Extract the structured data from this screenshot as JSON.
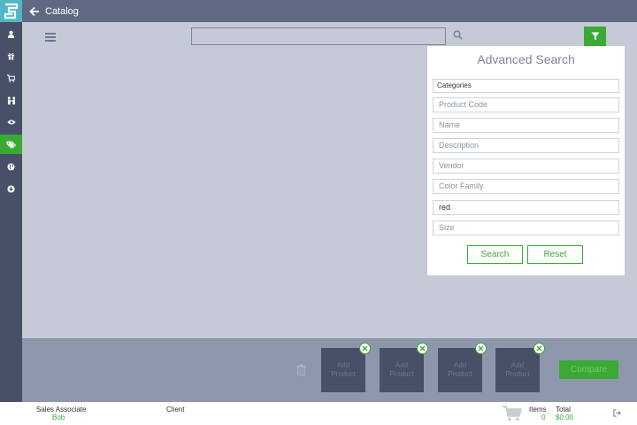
{
  "header": {
    "title": "Catalog"
  },
  "sidebar": {
    "items": [
      {
        "icon": "user-icon"
      },
      {
        "icon": "gift-icon"
      },
      {
        "icon": "cart-icon"
      },
      {
        "icon": "people-icon"
      },
      {
        "icon": "eye-icon"
      },
      {
        "icon": "tags-icon",
        "active": true
      },
      {
        "icon": "globe-icon"
      },
      {
        "icon": "download-icon"
      }
    ]
  },
  "search": {
    "value": "",
    "placeholder": ""
  },
  "advanced_search": {
    "title": "Advanced Search",
    "categories_label": "Categories",
    "fields": [
      {
        "placeholder": "Product Code",
        "value": ""
      },
      {
        "placeholder": "Name",
        "value": ""
      },
      {
        "placeholder": "Description",
        "value": ""
      },
      {
        "placeholder": "Vendor",
        "value": ""
      },
      {
        "placeholder": "Color Family",
        "value": ""
      },
      {
        "placeholder": "",
        "value": "red"
      },
      {
        "placeholder": "Size",
        "value": ""
      }
    ],
    "search_label": "Search",
    "reset_label": "Reset"
  },
  "tray": {
    "slots": [
      {
        "label_line1": "Add",
        "label_line2": "Product"
      },
      {
        "label_line1": "Add",
        "label_line2": "Product"
      },
      {
        "label_line1": "Add",
        "label_line2": "Product"
      },
      {
        "label_line1": "Add",
        "label_line2": "Product"
      }
    ],
    "compare_label": "Compare"
  },
  "footer": {
    "sales_associate_label": "Sales Associate",
    "sales_associate_value": "Bob",
    "client_label": "Client",
    "items_label": "Items",
    "items_value": "0",
    "total_label": "Total",
    "total_value": "$0.00"
  },
  "colors": {
    "accent": "#3aaa35",
    "sidebar": "#475066",
    "header": "#5f6a82",
    "main_bg": "#c5cad6",
    "tray_bg": "#8d96ab",
    "logo": "#4fb8c4"
  }
}
